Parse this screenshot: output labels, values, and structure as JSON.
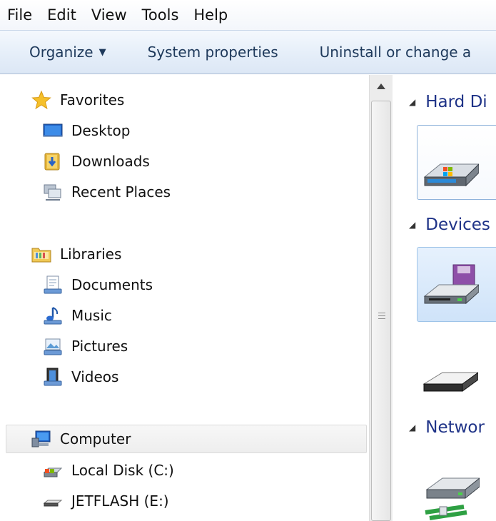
{
  "menu": {
    "items": [
      {
        "label": "File"
      },
      {
        "label": "Edit"
      },
      {
        "label": "View"
      },
      {
        "label": "Tools"
      },
      {
        "label": "Help"
      }
    ]
  },
  "toolbar": {
    "organize_label": "Organize",
    "system_properties_label": "System properties",
    "uninstall_label": "Uninstall or change a"
  },
  "nav": {
    "favorites": {
      "label": "Favorites",
      "items": [
        {
          "label": "Desktop"
        },
        {
          "label": "Downloads"
        },
        {
          "label": "Recent Places"
        }
      ]
    },
    "libraries": {
      "label": "Libraries",
      "items": [
        {
          "label": "Documents"
        },
        {
          "label": "Music"
        },
        {
          "label": "Pictures"
        },
        {
          "label": "Videos"
        }
      ]
    },
    "computer": {
      "label": "Computer",
      "items": [
        {
          "label": "Local Disk (C:)"
        },
        {
          "label": "JETFLASH (E:)"
        }
      ]
    }
  },
  "content": {
    "groups": [
      {
        "label": "Hard Di"
      },
      {
        "label": "Devices"
      },
      {
        "label": "Networ"
      }
    ]
  }
}
